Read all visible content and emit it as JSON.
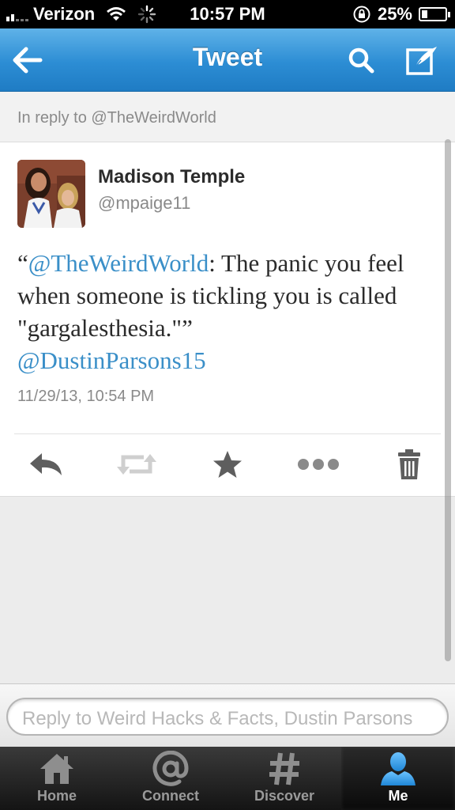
{
  "status_bar": {
    "carrier": "Verizon",
    "time": "10:57 PM",
    "battery_percent": "25%",
    "battery_level": 0.25,
    "signal_bars": 2
  },
  "nav": {
    "title": "Tweet",
    "back_icon": "back-arrow-icon",
    "search_icon": "search-icon",
    "compose_icon": "compose-icon"
  },
  "reply_context": "In reply to @TheWeirdWorld",
  "tweet": {
    "user_name": "Madison Temple",
    "user_handle": "@mpaige11",
    "text_open_quote": "“",
    "text_mention_1": "@TheWeirdWorld",
    "text_body": ": The panic you feel when someone is tickling you is called \"gargalesthesia.\"”",
    "text_mention_2": "@DustinParsons15",
    "timestamp": "11/29/13, 10:54 PM"
  },
  "actions": [
    "reply-icon",
    "retweet-icon",
    "favorite-icon",
    "more-icon",
    "trash-icon"
  ],
  "reply_input": {
    "placeholder": "Reply to Weird Hacks & Facts, Dustin Parsons"
  },
  "tabs": [
    {
      "label": "Home",
      "icon": "home-icon"
    },
    {
      "label": "Connect",
      "icon": "at-icon"
    },
    {
      "label": "Discover",
      "icon": "hashtag-icon"
    },
    {
      "label": "Me",
      "icon": "person-icon",
      "active": true
    }
  ],
  "colors": {
    "nav_blue": "#2c8dd4",
    "link_blue": "#3a8fc8",
    "me_tab_blue": "#2f9be6"
  }
}
